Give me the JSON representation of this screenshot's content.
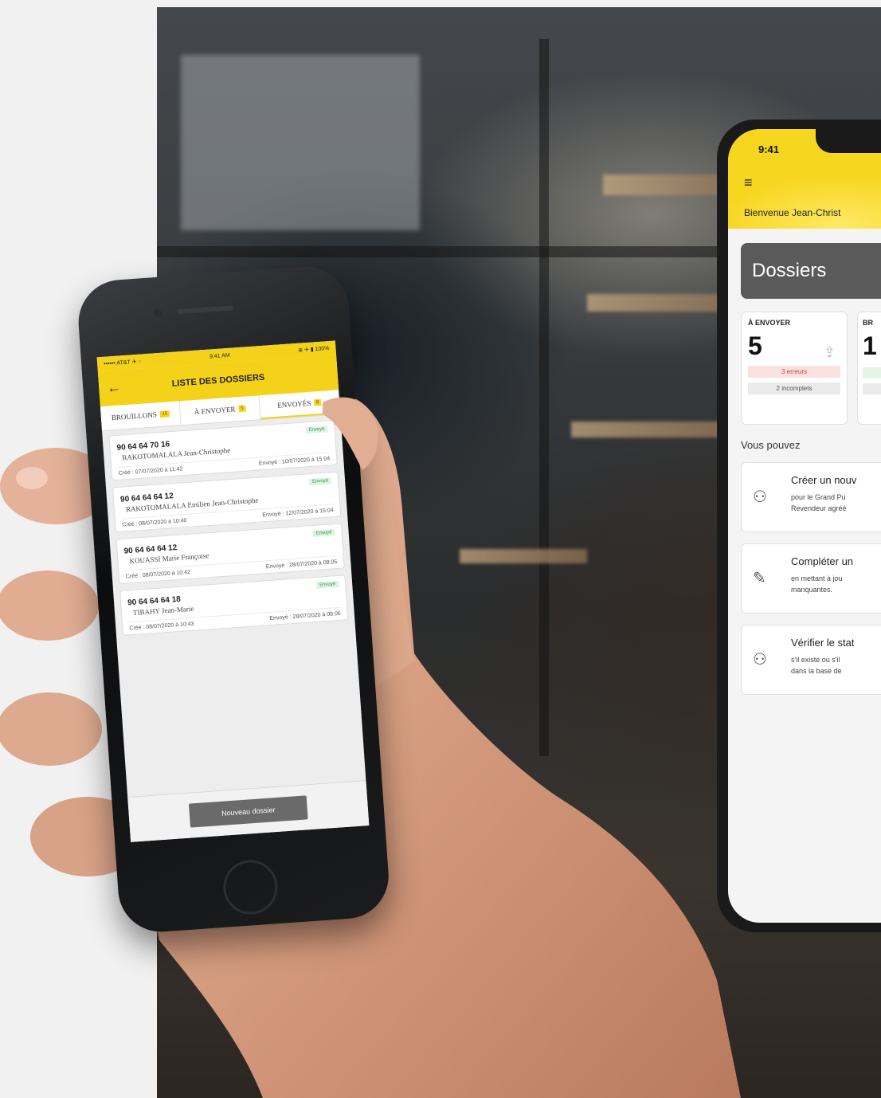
{
  "left_phone": {
    "status_bar": {
      "carrier": "•••••• AT&T ✈ ◌",
      "time": "9:41 AM",
      "battery": "⊕ ✈ ▮ 100%"
    },
    "title": "LISTE DES DOSSIERS",
    "tabs": [
      {
        "label": "BROUILLONS",
        "count": "15"
      },
      {
        "label": "À ENVOYER",
        "count": "5"
      },
      {
        "label": "ENVOYÉS",
        "count": "8"
      }
    ],
    "cards": [
      {
        "number": "90 64 64 70 16",
        "name": "RAKOTOMALALA Jean-Christophe",
        "status": "Envoyé",
        "created": "Créé : 07/07/2020 à 11:42",
        "sent": "Envoyé : 10/07/2020 à 15:04"
      },
      {
        "number": "90 64 64 64 12",
        "name": "RAKOTOMALALA Emilien Jean-Christophe",
        "status": "Envoyé",
        "created": "Créé : 08/07/2020 à 10:40",
        "sent": "Envoyé : 12/07/2020 à 15:04"
      },
      {
        "number": "90 64 64 64 12",
        "name": "KOUASSI Marie Françoise",
        "status": "Envoyé",
        "created": "Créé : 08/07/2020 à 10:42",
        "sent": "Envoyé : 28/07/2020 à 08:05"
      },
      {
        "number": "90 64 64 64 18",
        "name": "TIBAHY Jean-Marie",
        "status": "Envoyé",
        "created": "Créé : 08/07/2020 à 10:43",
        "sent": "Envoyé : 28/07/2020 à 08:06"
      }
    ],
    "new_button": "Nouveau dossier"
  },
  "right_phone": {
    "time": "9:41",
    "welcome": "Bienvenue Jean-Christ",
    "section_title": "Dossiers",
    "stat_send": {
      "label": "À ENVOYER",
      "value": "5",
      "errors": "3 erreurs",
      "incomplete": "2 incomplets"
    },
    "stat_partial": {
      "label": "BR",
      "value": "1"
    },
    "you_can": "Vous pouvez",
    "actions": [
      {
        "icon": "add-person-icon",
        "title": "Créer un nouv",
        "line1": "pour le Grand Pu",
        "line2": "Revendeur agréé"
      },
      {
        "icon": "pencil-icon",
        "title": "Compléter un",
        "line1": "en mettant à jou",
        "line2": "manquantes."
      },
      {
        "icon": "search-person-icon",
        "title": "Vérifier le stat",
        "line1": "s'il existe ou s'il",
        "line2": "dans la base de"
      }
    ]
  },
  "colors": {
    "brand_yellow": "#f5d21a",
    "dark_grey": "#5a5a5a",
    "error_red": "#d24040",
    "ok_green": "#2d9a3e"
  }
}
